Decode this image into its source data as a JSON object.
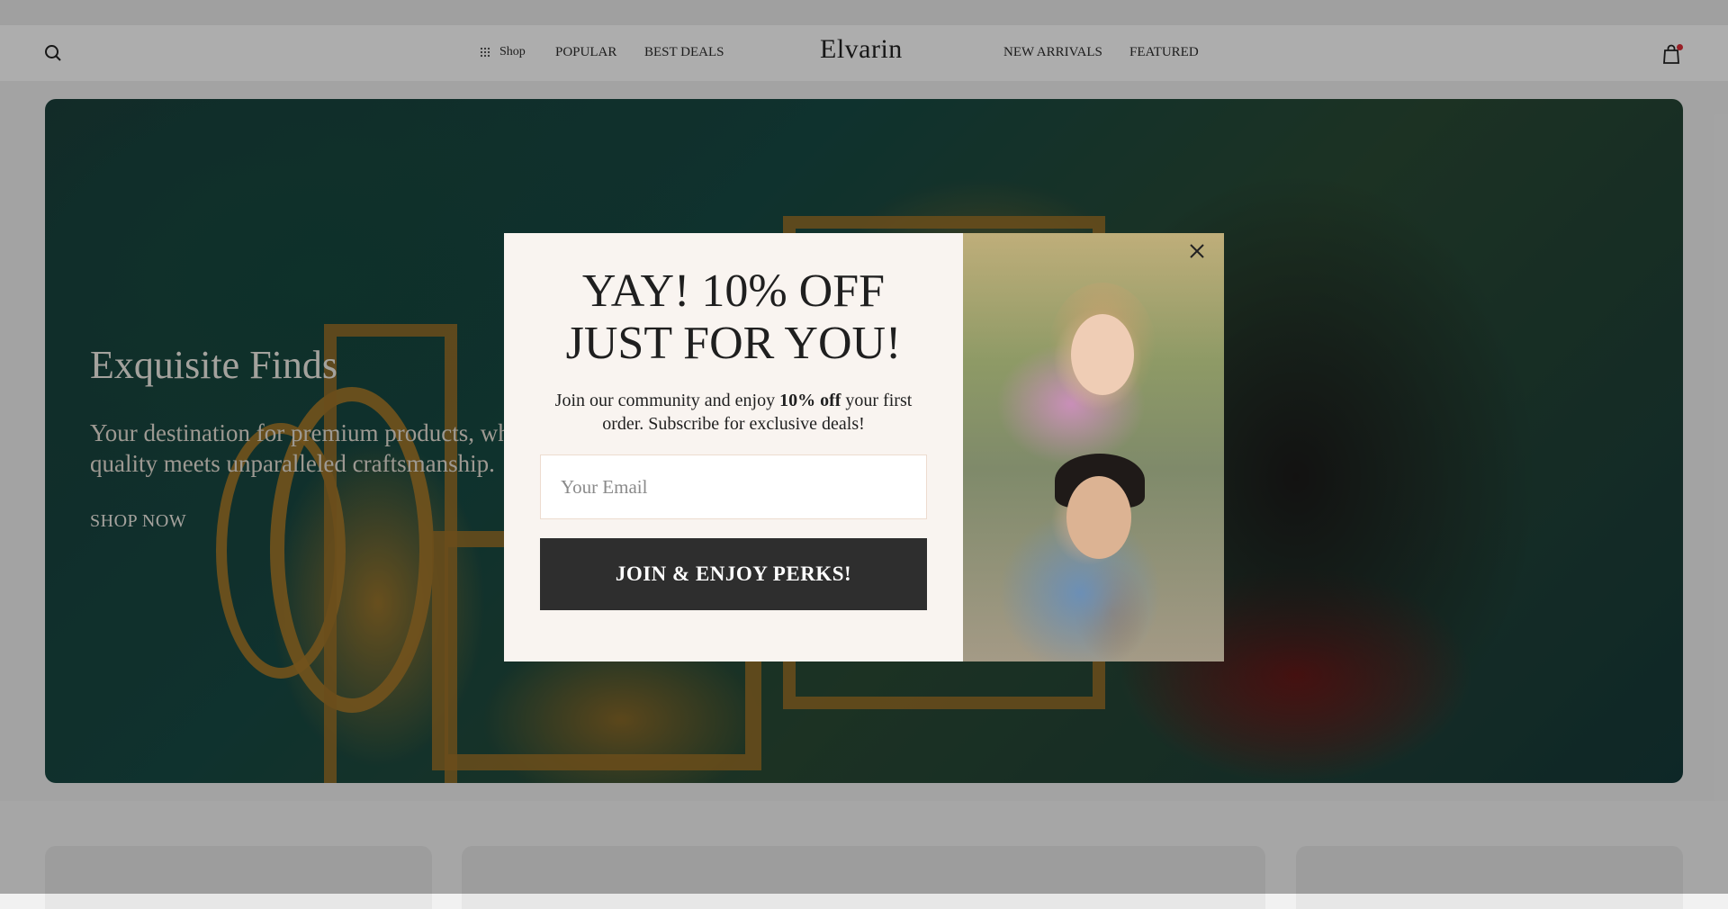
{
  "header": {
    "logo": "Elvarin",
    "nav_left": [
      {
        "label": "Shop",
        "icon": "grid-icon"
      },
      {
        "label": "POPULAR"
      },
      {
        "label": "BEST DEALS"
      }
    ],
    "nav_right": [
      {
        "label": "NEW ARRIVALS"
      },
      {
        "label": "FEATURED"
      }
    ],
    "icons": {
      "search": "search-icon",
      "cart": "shopping-bag-icon"
    }
  },
  "hero": {
    "title": "Exquisite Finds",
    "subtitle": "Your destination for premium products, where quality meets unparalleled craftsmanship.",
    "cta": "SHOP NOW"
  },
  "popup": {
    "heading_line1": "YAY! 10% OFF",
    "heading_line2": "JUST FOR YOU!",
    "desc_before": "Join our community and enjoy ",
    "desc_bold": "10% off",
    "desc_after": " your first order. Subscribe for exclusive deals!",
    "email_placeholder": "Your Email",
    "button_label": "JOIN & ENJOY PERKS!"
  },
  "colors": {
    "overlay": "rgba(0,0,0,0.32)",
    "modal_bg": "#f9f4f0",
    "button_bg": "#2e2e2e",
    "cart_badge": "#e0303a"
  }
}
